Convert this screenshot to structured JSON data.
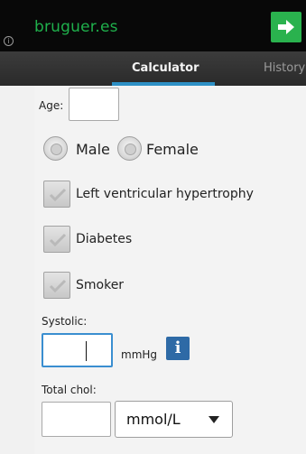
{
  "ad": {
    "brand": "bruguer.es",
    "info": "i"
  },
  "tabs": [
    {
      "label": "Calculator"
    },
    {
      "label": "History"
    }
  ],
  "form": {
    "age_label": "Age:",
    "age_value": "",
    "sex_options": [
      "Male",
      "Female"
    ],
    "checkboxes": [
      {
        "label": "Left ventricular hypertrophy",
        "checked": false
      },
      {
        "label": "Diabetes",
        "checked": false
      },
      {
        "label": "Smoker",
        "checked": false
      }
    ],
    "systolic_label": "Systolic:",
    "systolic_value": "",
    "systolic_unit": "mmHg",
    "info_button": "i",
    "chol_label": "Total chol:",
    "chol_value": "",
    "chol_unit": "mmol/L"
  },
  "colors": {
    "brand": "#1fb04c",
    "tab_accent": "#2d90c5",
    "info_button": "#2e6aa6",
    "focus_border": "#3a8ed0"
  }
}
